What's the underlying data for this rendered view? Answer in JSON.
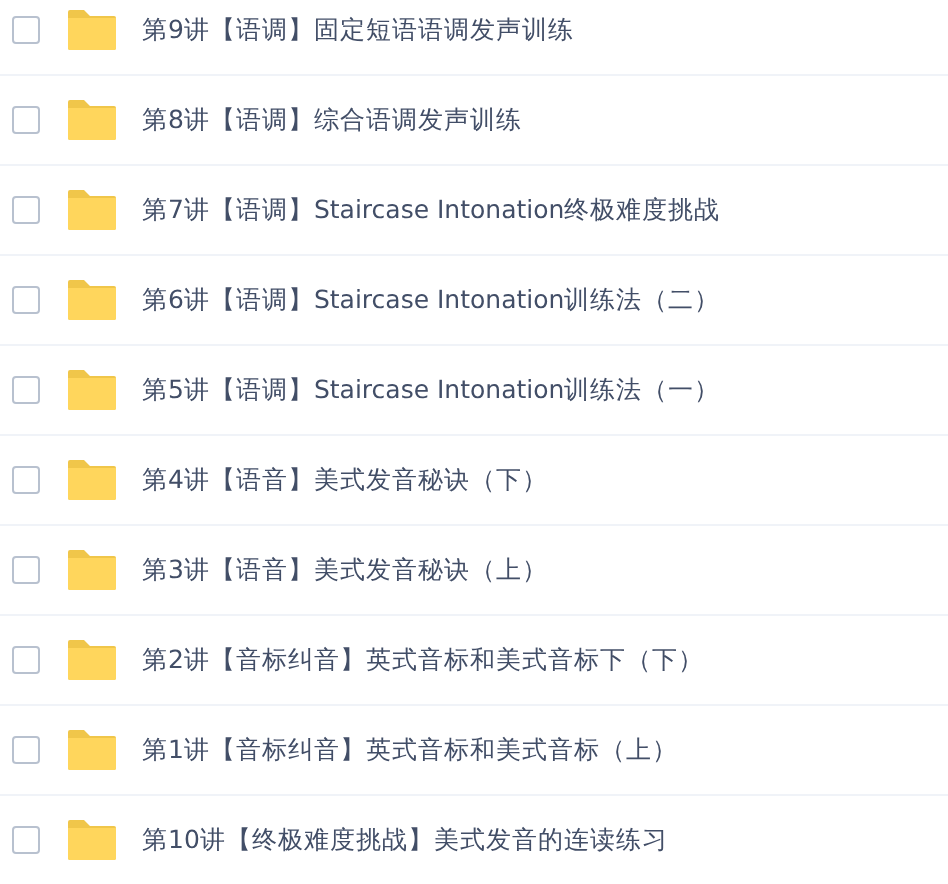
{
  "files": [
    {
      "name": "第9讲【语调】固定短语语调发声训练",
      "checked": false
    },
    {
      "name": "第8讲【语调】综合语调发声训练",
      "checked": false
    },
    {
      "name": "第7讲【语调】Staircase Intonation终极难度挑战",
      "checked": false
    },
    {
      "name": "第6讲【语调】Staircase Intonation训练法（二）",
      "checked": false
    },
    {
      "name": "第5讲【语调】Staircase Intonation训练法（一）",
      "checked": false
    },
    {
      "name": "第4讲【语音】美式发音秘诀（下）",
      "checked": false
    },
    {
      "name": "第3讲【语音】美式发音秘诀（上）",
      "checked": false
    },
    {
      "name": "第2讲【音标纠音】英式音标和美式音标下（下）",
      "checked": false
    },
    {
      "name": "第1讲【音标纠音】英式音标和美式音标（上）",
      "checked": false
    },
    {
      "name": "第10讲【终极难度挑战】美式发音的连读练习",
      "checked": false
    }
  ]
}
